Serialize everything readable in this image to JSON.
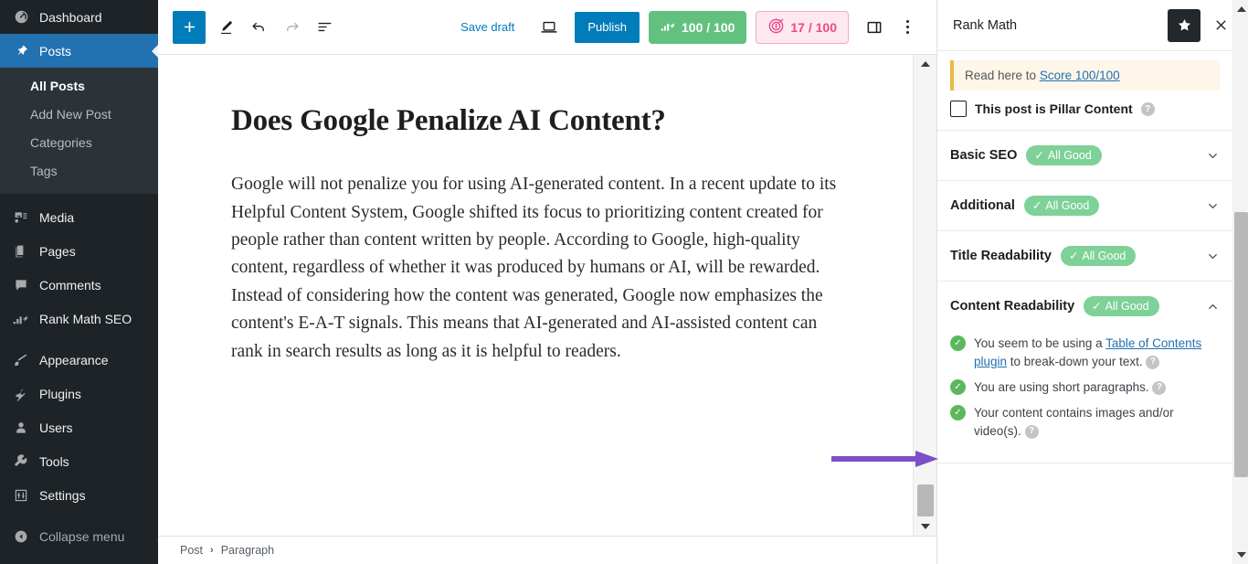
{
  "sidebar": {
    "items": [
      {
        "label": "Dashboard",
        "icon": "dashboard-icon",
        "active": false
      },
      {
        "label": "Posts",
        "icon": "pin-icon",
        "active": true
      },
      {
        "label": "Media",
        "icon": "media-icon",
        "active": false
      },
      {
        "label": "Pages",
        "icon": "pages-icon",
        "active": false
      },
      {
        "label": "Comments",
        "icon": "comments-icon",
        "active": false
      },
      {
        "label": "Rank Math SEO",
        "icon": "rank-math-icon",
        "active": false
      },
      {
        "label": "Appearance",
        "icon": "brush-icon",
        "active": false
      },
      {
        "label": "Plugins",
        "icon": "plug-icon",
        "active": false
      },
      {
        "label": "Users",
        "icon": "user-icon",
        "active": false
      },
      {
        "label": "Tools",
        "icon": "wrench-icon",
        "active": false
      },
      {
        "label": "Settings",
        "icon": "sliders-icon",
        "active": false
      }
    ],
    "submenu": [
      {
        "label": "All Posts",
        "current": true
      },
      {
        "label": "Add New Post",
        "current": false
      },
      {
        "label": "Categories",
        "current": false
      },
      {
        "label": "Tags",
        "current": false
      }
    ],
    "collapse": {
      "label": "Collapse menu",
      "icon": "collapse-left-icon"
    }
  },
  "toolbar": {
    "add_block_icon": "plus-icon",
    "tools_icon": "pencil-icon",
    "undo_icon": "undo-arrow-icon",
    "redo_icon": "redo-arrow-icon",
    "list_view_icon": "list-view-icon",
    "save_draft_label": "Save draft",
    "preview_icon": "laptop-preview-icon",
    "publish_label": "Publish",
    "seo_score_label": "100 / 100",
    "seo_score_icon": "rank-math-icon",
    "ai_score_label": "17 / 100",
    "ai_score_icon": "content-ai-icon",
    "settings_sidebar_icon": "sidebar-toggle-icon",
    "options_icon": "kebab-menu-icon"
  },
  "post": {
    "title": "Does Google Penalize AI Content?",
    "paragraph": "Google will not penalize you for using AI-generated content. In a recent update to its Helpful Content System, Google shifted its focus to prioritizing content created for people rather than content written by people. According to Google, high-quality content, regardless of whether it was produced by humans or AI, will be rewarded. Instead of considering how the content was generated, Google now emphasizes the content's E-A-T signals. This means that AI-generated and AI-assisted content can rank in search results as long as it is helpful to readers."
  },
  "breadcrumb": {
    "items": [
      "Post",
      "Paragraph"
    ],
    "separator": "›"
  },
  "rank_math": {
    "title": "Rank Math",
    "star_icon": "star-icon",
    "close_icon": "close-icon",
    "notice": {
      "prefix": "Read here to ",
      "link": "Score 100/100"
    },
    "pillar": {
      "label": "This post is Pillar Content",
      "help_icon": "help-icon",
      "checked": false
    },
    "sections": [
      {
        "name": "Basic SEO",
        "badge": "All Good",
        "expanded": false,
        "chevron": "chevron-down-icon"
      },
      {
        "name": "Additional",
        "badge": "All Good",
        "expanded": false,
        "chevron": "chevron-down-icon"
      },
      {
        "name": "Title Readability",
        "badge": "All Good",
        "expanded": false,
        "chevron": "chevron-down-icon"
      },
      {
        "name": "Content Readability",
        "badge": "All Good",
        "expanded": true,
        "chevron": "chevron-up-icon"
      }
    ],
    "content_readability_items": [
      {
        "before": "You seem to be using a ",
        "link": "Table of Contents plugin",
        "after": " to break-down your text.",
        "status": "ok"
      },
      {
        "before": "You are using short paragraphs.",
        "link": "",
        "after": "",
        "status": "ok"
      },
      {
        "before": "Your content contains images and/or video(s).",
        "link": "",
        "after": "",
        "status": "ok"
      }
    ]
  },
  "annotation": {
    "arrow_color": "#7B4FC9",
    "arrow_name": "callout-arrow"
  },
  "colors": {
    "wp_sidebar_bg": "#1d2327",
    "wp_active_blue": "#2271b1",
    "publish_blue": "#007cba",
    "seo_green": "#62c17f",
    "ai_pink_bg": "#fde9ef",
    "ai_pink_text": "#ec4a89",
    "badge_green": "#7ed197",
    "notice_bg": "#fdf6e9",
    "notice_border": "#e9b949",
    "link_blue": "#2271b1"
  }
}
